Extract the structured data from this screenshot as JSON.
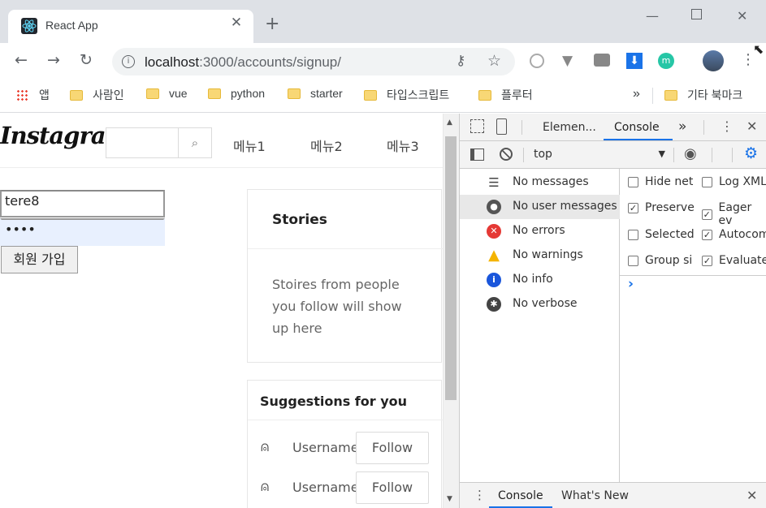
{
  "browser": {
    "tab_title": "React App",
    "url_host": "localhost",
    "url_path": ":3000/accounts/signup/",
    "bookmarks": [
      "앱",
      "사람인",
      "vue",
      "python",
      "starter",
      "타입스크립트",
      "플루터"
    ],
    "bookmarks_overflow": "»",
    "other_bookmarks": "기타 북마크"
  },
  "page": {
    "logo": "Instagram",
    "menus": [
      "메뉴1",
      "메뉴2",
      "메뉴3"
    ],
    "username_value": "tere8",
    "password_value": "••••",
    "signup_label": "회원 가입",
    "stories_title": "Stories",
    "stories_text_1": "Stoires from people",
    "stories_text_2": "you follow will show",
    "stories_text_3": "up here",
    "suggestions_title": "Suggestions for you",
    "suggestions": [
      {
        "username": "Username",
        "follow": "Follow"
      },
      {
        "username": "Username",
        "follow": "Follow"
      }
    ]
  },
  "devtools": {
    "tabs": [
      "Elemen...",
      "Console"
    ],
    "active_tab": "Console",
    "more": "»",
    "context": "top",
    "sidebar": [
      "No messages",
      "No user messages",
      "No errors",
      "No warnings",
      "No info",
      "No verbose"
    ],
    "options": [
      {
        "label": "Hide net",
        "checked": false
      },
      {
        "label": "Log XML",
        "checked": false
      },
      {
        "label": "Preserve",
        "checked": true
      },
      {
        "label": "Eager ev",
        "checked": true
      },
      {
        "label": "Selected",
        "checked": false
      },
      {
        "label": "Autocom",
        "checked": true
      },
      {
        "label": "Group si",
        "checked": false
      },
      {
        "label": "Evaluate",
        "checked": true
      }
    ],
    "prompt": "›",
    "drawer_tabs": [
      "Console",
      "What's New"
    ]
  },
  "colors": {
    "accent": "#1a73e8",
    "error": "#e53935",
    "warning": "#f4b400",
    "info": "#1a56db"
  }
}
